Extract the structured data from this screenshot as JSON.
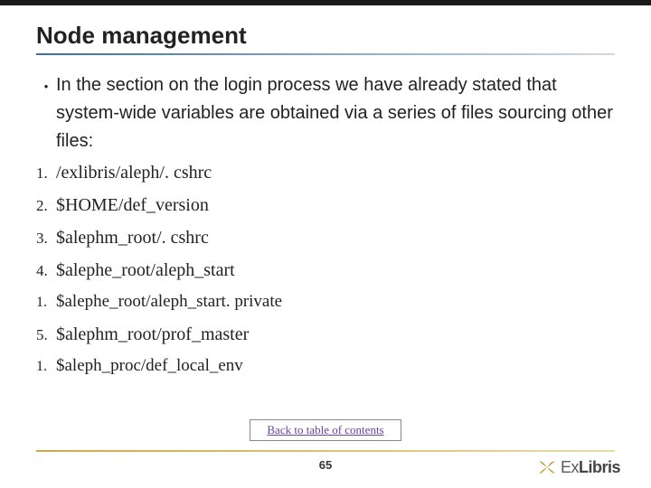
{
  "title": "Node management",
  "bullet": {
    "marker": "•",
    "text": "In the section on the login process we have already stated that system-wide variables are obtained via a series of files sourcing other files:"
  },
  "items": [
    {
      "marker": "1.",
      "text": "/exlibris/aleph/. cshrc"
    },
    {
      "marker": "2.",
      "text": "$HOME/def_version"
    },
    {
      "marker": "3.",
      "text": "$alephm_root/. cshrc"
    },
    {
      "marker": "4.",
      "text": "$alephe_root/aleph_start",
      "sub": [
        {
          "marker": "1.",
          "text": "$alephe_root/aleph_start. private"
        }
      ]
    },
    {
      "marker": "5.",
      "text": "$alephm_root/prof_master",
      "sub": [
        {
          "marker": "1.",
          "text": "$aleph_proc/def_local_env"
        }
      ]
    }
  ],
  "back_link": "Back to table of contents",
  "page_number": "65",
  "logo": {
    "prefix": "Ex",
    "suffix": "Libris"
  }
}
